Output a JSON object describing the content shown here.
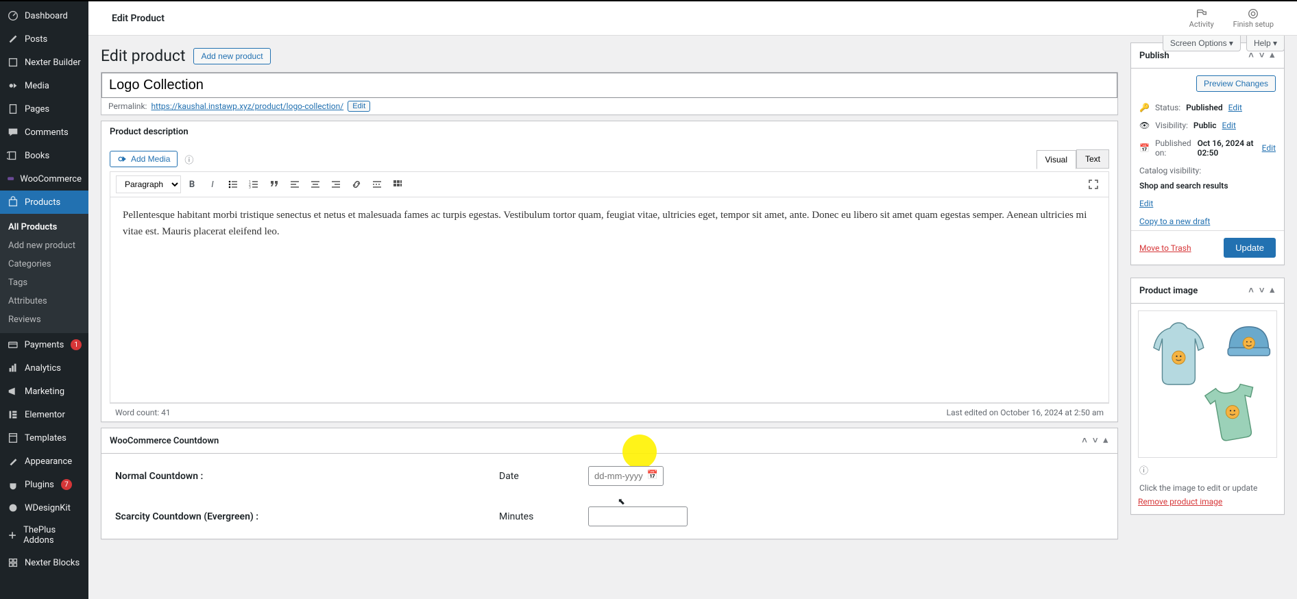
{
  "sidebar": {
    "items": [
      {
        "label": "Dashboard",
        "icon": "dashboard"
      },
      {
        "label": "Posts",
        "icon": "pin"
      },
      {
        "label": "Nexter Builder",
        "icon": "box"
      },
      {
        "label": "Media",
        "icon": "media"
      },
      {
        "label": "Pages",
        "icon": "page"
      },
      {
        "label": "Comments",
        "icon": "comment"
      },
      {
        "label": "Books",
        "icon": "book"
      },
      {
        "label": "WooCommerce",
        "icon": "woo"
      },
      {
        "label": "Products",
        "icon": "product",
        "active": true
      },
      {
        "label": "Payments",
        "icon": "card",
        "badge": "1"
      },
      {
        "label": "Analytics",
        "icon": "bar"
      },
      {
        "label": "Marketing",
        "icon": "mega"
      },
      {
        "label": "Elementor",
        "icon": "elem"
      },
      {
        "label": "Templates",
        "icon": "tmpl"
      },
      {
        "label": "Appearance",
        "icon": "brush"
      },
      {
        "label": "Plugins",
        "icon": "plug",
        "badge": "7"
      },
      {
        "label": "WDesignKit",
        "icon": "wd"
      },
      {
        "label": "ThePlus Addons",
        "icon": "plus"
      },
      {
        "label": "Nexter Blocks",
        "icon": "nb"
      }
    ],
    "submenu": [
      "All Products",
      "Add new product",
      "Categories",
      "Tags",
      "Attributes",
      "Reviews"
    ]
  },
  "topbar": {
    "title": "Edit Product",
    "activity": "Activity",
    "finish": "Finish setup"
  },
  "screen_opts": {
    "screen": "Screen Options ▾",
    "help": "Help ▾"
  },
  "header": {
    "h1": "Edit product",
    "add_new": "Add new product"
  },
  "product": {
    "title": "Logo Collection",
    "permalink_label": "Permalink:",
    "permalink_url": "https://kaushal.instawp.xyz/product/logo-collection/",
    "edit": "Edit"
  },
  "editor": {
    "box_title": "Product description",
    "add_media": "Add Media",
    "visual": "Visual",
    "text": "Text",
    "para": "Paragraph",
    "body": "Pellentesque habitant morbi tristique senectus et netus et malesuada fames ac turpis egestas. Vestibulum tortor quam, feugiat vitae, ultricies eget, tempor sit amet, ante. Donec eu libero sit amet quam egestas semper. Aenean ultricies mi vitae est. Mauris placerat eleifend leo.",
    "word_count": "Word count: 41",
    "last_edit": "Last edited on October 16, 2024 at 2:50 am"
  },
  "countdown": {
    "box_title": "WooCommerce Countdown",
    "normal": "Normal Countdown :",
    "date_label": "Date",
    "date_placeholder": "dd-mm-yyyy",
    "scarcity": "Scarcity Countdown (Evergreen) :",
    "minutes_label": "Minutes"
  },
  "publish": {
    "box_title": "Publish",
    "preview": "Preview Changes",
    "status_l": "Status:",
    "status_v": "Published",
    "edit": "Edit",
    "vis_l": "Visibility:",
    "vis_v": "Public",
    "pub_l": "Published on:",
    "pub_v": "Oct 16, 2024 at 02:50",
    "cat_l": "Catalog visibility:",
    "cat_v": "Shop and search results",
    "copy": "Copy to a new draft",
    "trash": "Move to Trash",
    "update": "Update"
  },
  "image_box": {
    "box_title": "Product image",
    "help_icon": "?",
    "click_text": "Click the image to edit or update",
    "remove": "Remove product image"
  }
}
